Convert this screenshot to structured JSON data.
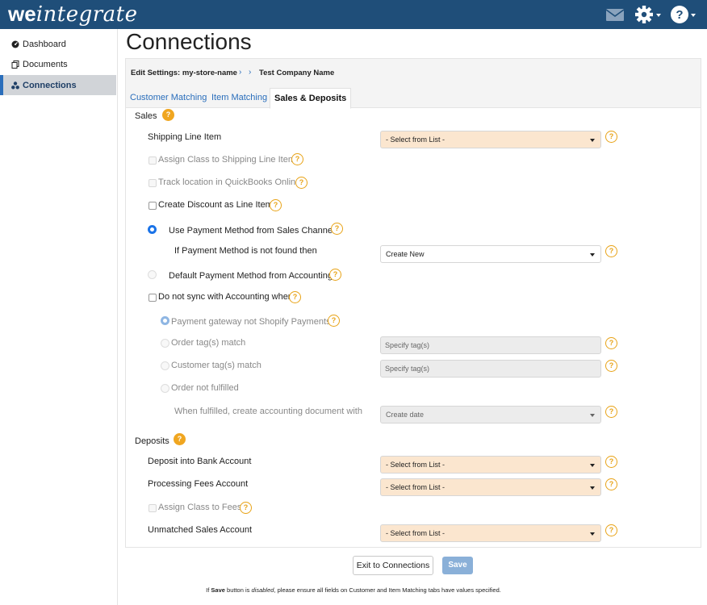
{
  "brand": {
    "bold": "we",
    "italic": "integrate"
  },
  "topbar_icons": [
    "mail-icon",
    "gear-icon",
    "help-icon"
  ],
  "colors": {
    "topbar": "#1f4e79",
    "accent": "#2a6ebb",
    "select_bg": "#fbe6cf",
    "help": "#f0a620",
    "save_disabled": "#8ab0d8"
  },
  "sidebar": {
    "items": [
      {
        "label": "Dashboard",
        "icon": "dashboard-icon"
      },
      {
        "label": "Documents",
        "icon": "documents-icon"
      },
      {
        "label": "Connections",
        "icon": "connections-icon",
        "active": true
      }
    ]
  },
  "page": {
    "title": "Connections"
  },
  "breadcrumb": {
    "edit_settings": "Edit Settings: my-store-name",
    "company": "Test Company Name"
  },
  "tabs": [
    {
      "label": "Customer Matching"
    },
    {
      "label": "Item Matching"
    },
    {
      "label": "Sales & Deposits",
      "active": true
    }
  ],
  "sales": {
    "heading": "Sales",
    "shipping_line_item": {
      "label": "Shipping Line Item",
      "value": "- Select from List -"
    },
    "assign_class_shipping": {
      "label": "Assign Class to Shipping Line Item",
      "disabled": true
    },
    "track_location": {
      "label": "Track location in QuickBooks Online",
      "disabled": true
    },
    "create_discount": {
      "label": "Create Discount as Line Item",
      "checked": false
    },
    "use_payment_method": {
      "label": "Use Payment Method from Sales Channel",
      "selected": true
    },
    "payment_not_found": {
      "label": "If Payment Method is not found then",
      "value": "Create New"
    },
    "default_payment_method": {
      "label": "Default Payment Method from Accounting",
      "selected": false
    },
    "do_not_sync": {
      "label": "Do not sync with Accounting when",
      "checked": false
    },
    "gateway_not_shopify": {
      "label": "Payment gateway not Shopify Payments",
      "selected": true,
      "disabled": true
    },
    "order_tags": {
      "label": "Order tag(s) match",
      "placeholder": "Specify tag(s)"
    },
    "customer_tags": {
      "label": "Customer tag(s) match",
      "placeholder": "Specify tag(s)"
    },
    "order_not_fulfilled": {
      "label": "Order not fulfilled"
    },
    "when_fulfilled": {
      "label": "When fulfilled, create accounting document with",
      "value": "Create date"
    }
  },
  "deposits": {
    "heading": "Deposits",
    "bank_account": {
      "label": "Deposit into Bank Account",
      "value": "- Select from List -"
    },
    "fees_account": {
      "label": "Processing Fees Account",
      "value": "- Select from List -"
    },
    "assign_class_fees": {
      "label": "Assign Class to Fees",
      "disabled": true
    },
    "unmatched_account": {
      "label": "Unmatched Sales Account",
      "value": "- Select from List -"
    }
  },
  "help_symbol": "?",
  "buttons": {
    "exit": "Exit to Connections",
    "save": "Save"
  },
  "footnote": {
    "part1": "If ",
    "save": "Save",
    "part2": " button is ",
    "disabled": "disabled",
    "part3": ", please ensure all fields on Customer and Item Matching tabs have values specified."
  }
}
